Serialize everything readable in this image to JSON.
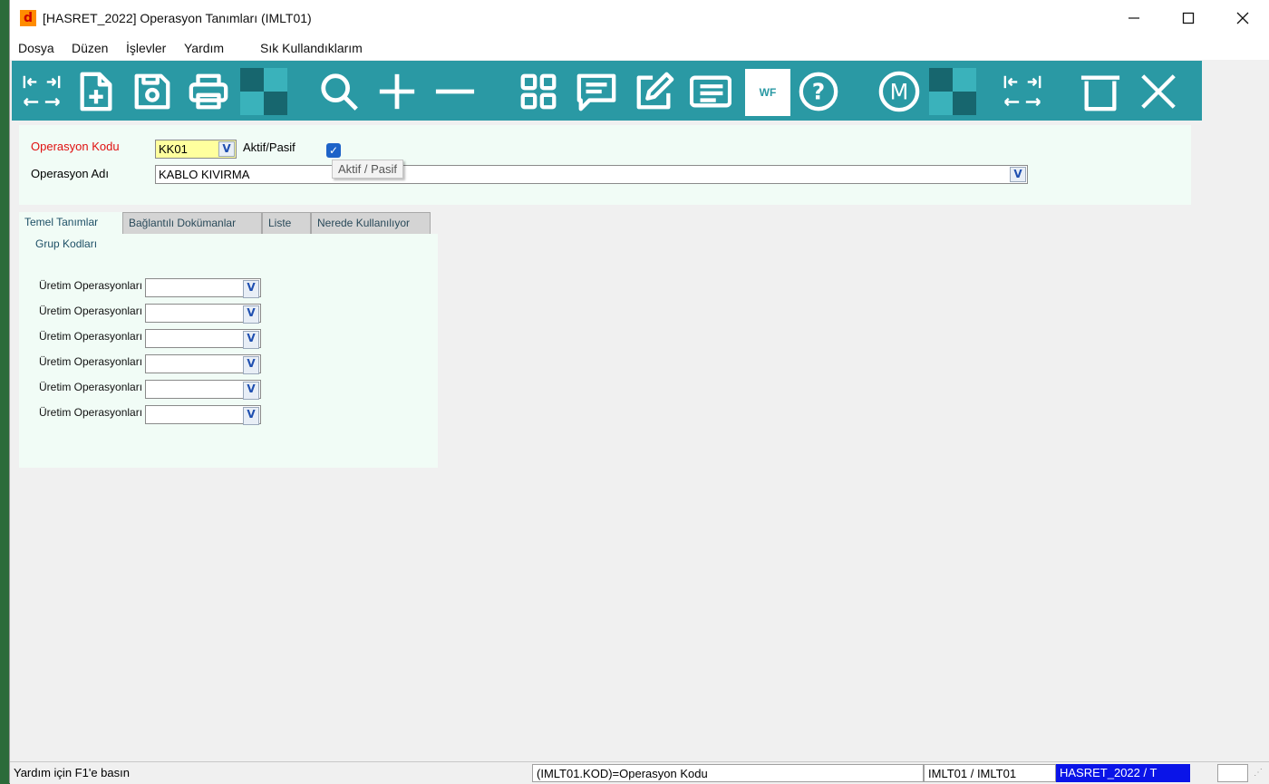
{
  "window": {
    "title": "[HASRET_2022] Operasyon Tanımları  (IMLT01)",
    "logo_letter": "d",
    "controls": {
      "minimize": "—",
      "maximize": "☐",
      "close": "✕"
    }
  },
  "menu": [
    "Dosya",
    "Düzen",
    "İşlevler",
    "Yardım",
    "Sık Kullandıklarım"
  ],
  "toolbar": {
    "icons": [
      "first-last-nav-icon",
      "new-document-icon",
      "save-icon",
      "print-icon",
      "search-icon",
      "add-icon",
      "remove-icon",
      "grid-icon",
      "comment-icon",
      "edit-icon",
      "list-icon",
      "help-icon",
      "m-icon",
      "nav-arrows-icon",
      "delete-icon",
      "close-icon"
    ],
    "wf_label": "WF",
    "help_symbol": "?",
    "m_symbol": "M",
    "colors": {
      "background": "#2a99a4",
      "checker_dark": "#17666e",
      "checker_light": "#3ab2bb"
    }
  },
  "form": {
    "operasyon_kodu_label": "Operasyon Kodu",
    "operasyon_kodu_value": "KK01",
    "aktif_pasif_label": "Aktif/Pasif",
    "aktif_pasif_checked": true,
    "operasyon_adi_label": "Operasyon Adı",
    "operasyon_adi_value": "KABLO KIVIRMA",
    "tooltip": "Aktif / Pasif"
  },
  "tabs": [
    {
      "label": "Temel Tanımlar",
      "active": true
    },
    {
      "label": "Bağlantılı Dokümanlar",
      "active": false
    },
    {
      "label": "Liste",
      "active": false
    },
    {
      "label": "Nerede Kullanılıyor",
      "active": false
    }
  ],
  "group": {
    "title": "Grup Kodları",
    "rows": [
      {
        "label": "Üretim Operasyonları",
        "value": ""
      },
      {
        "label": "Üretim Operasyonları",
        "value": ""
      },
      {
        "label": "Üretim Operasyonları",
        "value": ""
      },
      {
        "label": "Üretim Operasyonları",
        "value": ""
      },
      {
        "label": "Üretim Operasyonları",
        "value": ""
      },
      {
        "label": "Üretim Operasyonları",
        "value": ""
      }
    ]
  },
  "dropdown_symbol": "V",
  "status": {
    "help": "Yardım için F1'e basın",
    "field": "(IMLT01.KOD)=Operasyon Kodu",
    "form": "IMLT01 / IMLT01",
    "company": "HASRET_2022 / T"
  }
}
